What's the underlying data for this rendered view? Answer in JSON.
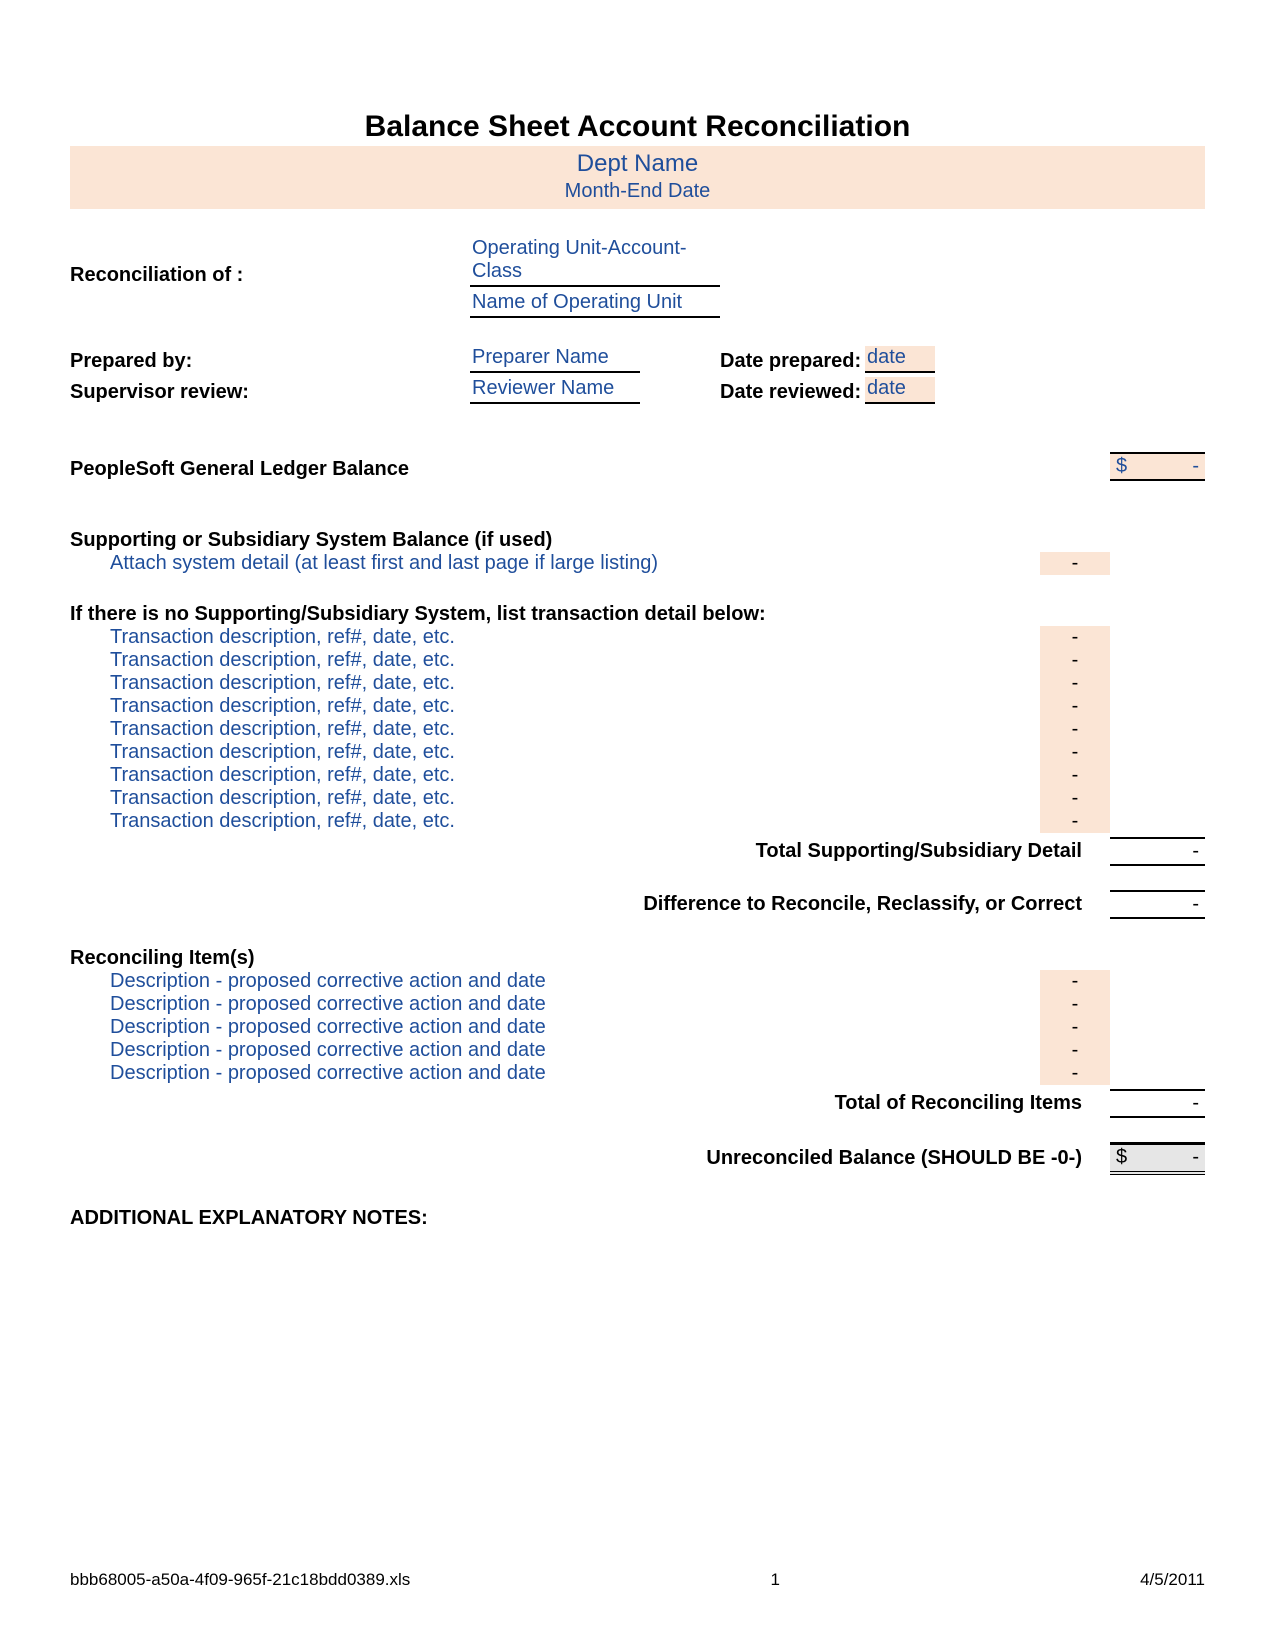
{
  "title": "Balance Sheet Account Reconciliation",
  "header": {
    "dept": "Dept Name",
    "month_end": "Month-End Date"
  },
  "recon_of": {
    "label": "Reconciliation of :",
    "line1": "Operating Unit-Account-Class",
    "line2": "Name of Operating Unit"
  },
  "prep": {
    "by_label": "Prepared by:",
    "by_value": "Preparer Name",
    "date_label": "Date prepared:",
    "date_value": "date",
    "rev_label": "Supervisor review:",
    "rev_value": "Reviewer Name",
    "rev_date_label": "Date reviewed:",
    "rev_date_value": "date"
  },
  "gl": {
    "label": "PeopleSoft General Ledger Balance",
    "symbol": "$",
    "value": "-"
  },
  "support": {
    "heading": "Supporting or Subsidiary System Balance (if used)",
    "attach": "Attach system detail (at least first and last page if large listing)",
    "attach_amt": "-"
  },
  "txn_heading": "If there is no Supporting/Subsidiary System, list transaction detail below:",
  "txns": [
    {
      "desc": "Transaction description, ref#, date, etc.",
      "amt": "-"
    },
    {
      "desc": "Transaction description, ref#, date, etc.",
      "amt": "-"
    },
    {
      "desc": "Transaction description, ref#, date, etc.",
      "amt": "-"
    },
    {
      "desc": "Transaction description, ref#, date, etc.",
      "amt": "-"
    },
    {
      "desc": "Transaction description, ref#, date, etc.",
      "amt": "-"
    },
    {
      "desc": "Transaction description, ref#, date, etc.",
      "amt": "-"
    },
    {
      "desc": "Transaction description, ref#, date, etc.",
      "amt": "-"
    },
    {
      "desc": "Transaction description, ref#, date, etc.",
      "amt": "-"
    },
    {
      "desc": "Transaction description, ref#, date, etc.",
      "amt": "-"
    }
  ],
  "total_support": {
    "label": "Total Supporting/Subsidiary Detail",
    "value": "-"
  },
  "difference": {
    "label": "Difference to Reconcile, Reclassify, or Correct",
    "value": "-"
  },
  "recon_items_heading": "Reconciling Item(s)",
  "recon_items": [
    {
      "desc": "Description - proposed corrective action and date",
      "amt": "-"
    },
    {
      "desc": "Description - proposed corrective action and date",
      "amt": "-"
    },
    {
      "desc": "Description - proposed corrective action and date",
      "amt": "-"
    },
    {
      "desc": "Description - proposed corrective action and date",
      "amt": "-"
    },
    {
      "desc": "Description - proposed corrective action and date",
      "amt": "-"
    }
  ],
  "total_recon": {
    "label": "Total of Reconciling Items",
    "value": "-"
  },
  "unreconciled": {
    "label": "Unreconciled Balance (SHOULD BE -0-)",
    "symbol": "$",
    "value": "-"
  },
  "notes_heading": "ADDITIONAL EXPLANATORY NOTES:",
  "footer": {
    "file": "bbb68005-a50a-4f09-965f-21c18bdd0389.xls",
    "page": "1",
    "date": "4/5/2011"
  }
}
